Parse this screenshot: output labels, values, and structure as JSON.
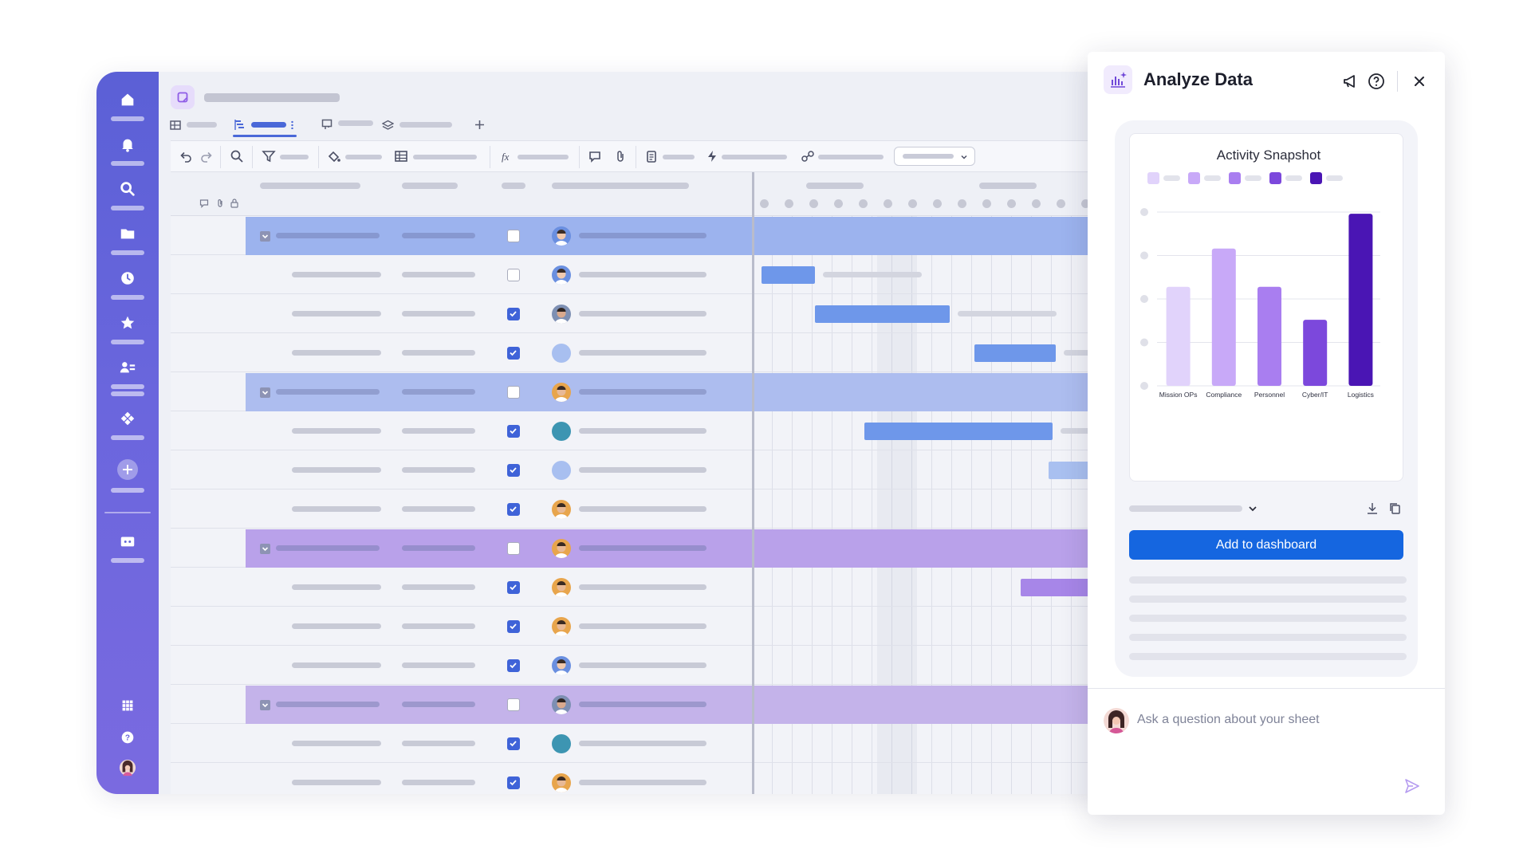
{
  "panel": {
    "title": "Analyze Data",
    "add_button_label": "Add to dashboard",
    "ask_placeholder": "Ask a question about your sheet"
  },
  "chart_data": {
    "type": "bar",
    "title": "Activity Snapshot",
    "categories": [
      "Mission OPs",
      "Compliance",
      "Personnel",
      "Cyber/IT",
      "Logistics"
    ],
    "values": [
      57,
      79,
      57,
      38,
      99
    ],
    "ylim": [
      0,
      100
    ],
    "colors": [
      "#e1d3fb",
      "#c8a9f8",
      "#a97ef0",
      "#7c48dc",
      "#4a15b4"
    ],
    "grid": true,
    "legend_placement": "top"
  },
  "colors": {
    "rail": "#6065d8",
    "accent_blue": "#1566e0",
    "group_blue": "#9cb2ee",
    "group_purple": "#b9a1ea",
    "bar_blue": "#6e97ea",
    "bar_purple": "#a786e8"
  },
  "rows": [
    {
      "group": true,
      "color": "blue",
      "checked": false,
      "avatar": "man1"
    },
    {
      "group": false,
      "color": "blue",
      "checked": false,
      "avatar": "man1",
      "bar": [
        0.02,
        0.17
      ]
    },
    {
      "group": false,
      "color": "blue",
      "checked": true,
      "avatar": "man2",
      "bar": [
        0.17,
        0.55
      ]
    },
    {
      "group": false,
      "color": "blue",
      "checked": true,
      "avatar": "blank",
      "bar": [
        0.62,
        0.85
      ]
    },
    {
      "group": true,
      "color": "blue2",
      "checked": false,
      "avatar": "man3"
    },
    {
      "group": false,
      "color": "blue",
      "checked": true,
      "avatar": "teal",
      "bar": [
        0.31,
        0.84
      ]
    },
    {
      "group": false,
      "color": "blue",
      "checked": true,
      "avatar": "blank",
      "bar": [
        0.83,
        0.98
      ]
    },
    {
      "group": false,
      "color": "blue",
      "checked": true,
      "avatar": "man3",
      "bar": [
        0.96,
        1.0
      ]
    },
    {
      "group": true,
      "color": "purple",
      "checked": false,
      "avatar": "man3"
    },
    {
      "group": false,
      "color": "purple",
      "checked": true,
      "avatar": "man3",
      "bar": [
        0.75,
        1.0
      ]
    },
    {
      "group": false,
      "color": "purple",
      "checked": true,
      "avatar": "man3"
    },
    {
      "group": false,
      "color": "purple",
      "checked": true,
      "avatar": "man1"
    },
    {
      "group": true,
      "color": "purple2",
      "checked": false,
      "avatar": "man2"
    },
    {
      "group": false,
      "color": "purple",
      "checked": true,
      "avatar": "teal"
    },
    {
      "group": false,
      "color": "purple",
      "checked": true,
      "avatar": "man3"
    }
  ]
}
